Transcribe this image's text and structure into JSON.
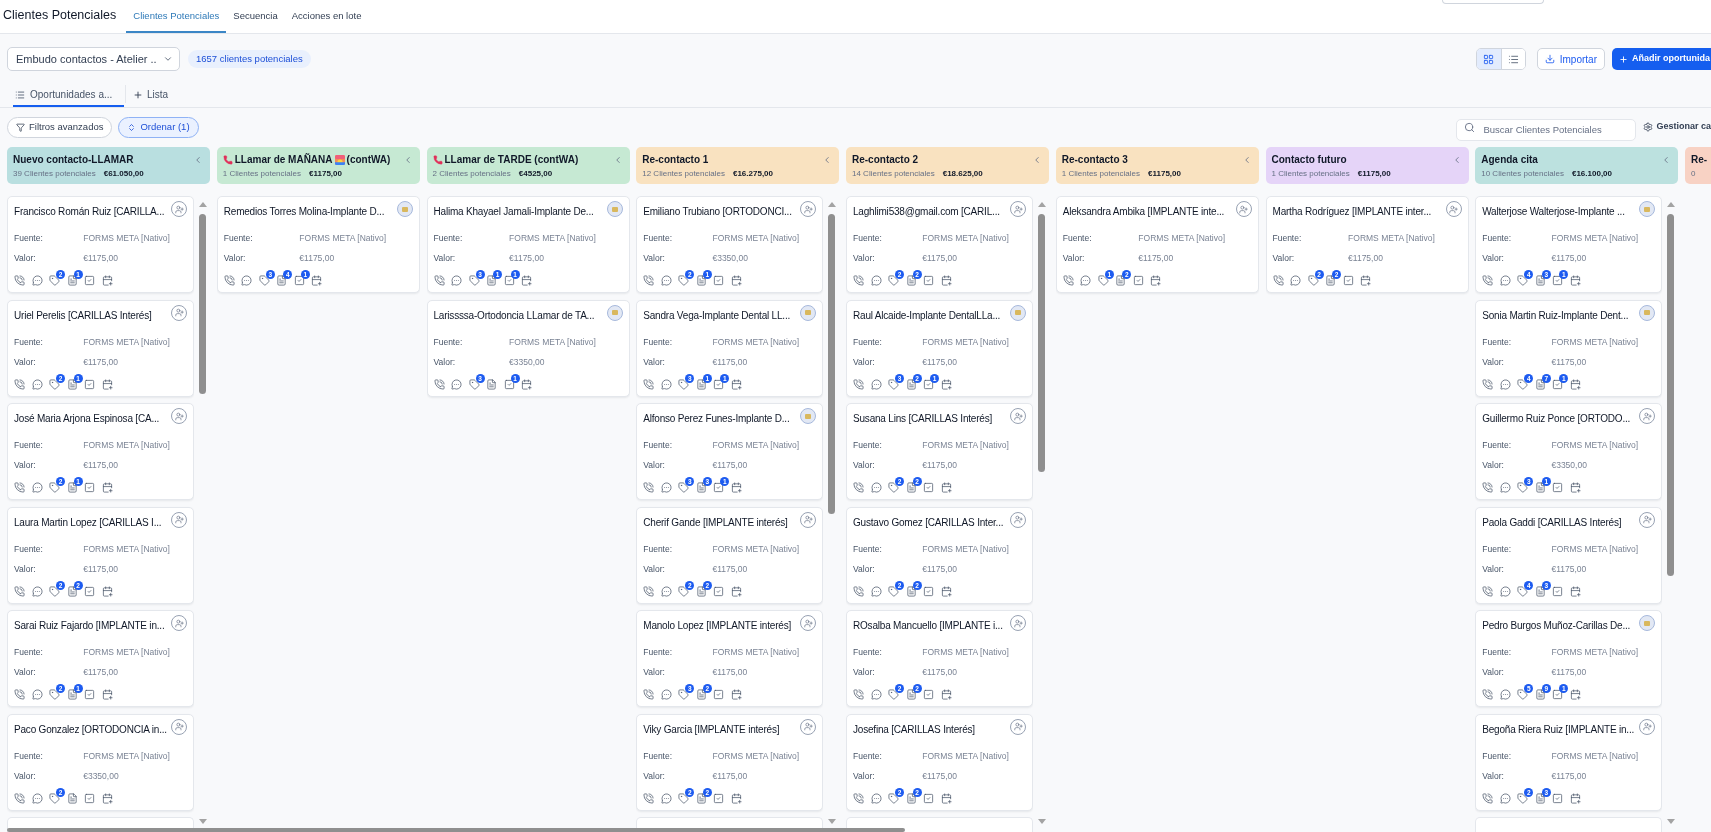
{
  "header": {
    "title": "Clientes Potenciales",
    "tabs": [
      {
        "label": "Clientes Potenciales",
        "selected": true
      },
      {
        "label": "Secuencia",
        "selected": false
      },
      {
        "label": "Acciones en lote",
        "selected": false
      }
    ]
  },
  "toolbar": {
    "pipeline": "Embudo contactos - Atelier ..",
    "lead_total": "1657 clientes potenciales",
    "views": [
      {
        "kind": "grid",
        "selected": true
      },
      {
        "kind": "list",
        "selected": false
      }
    ],
    "import": "Importar",
    "add": "Añadir oportunida"
  },
  "view_tabs": [
    {
      "label": "Oportunidades a...",
      "selected": true
    }
  ],
  "add_view": "Lista",
  "filters": {
    "advanced": "Filtros avanzados",
    "sort": {
      "label": "Ordenar (1)",
      "active": true
    },
    "search": {
      "placeholder": "Buscar Clientes Potenciales"
    },
    "manage": "Gestionar ca"
  },
  "columns": [
    {
      "title": "Nuevo contacto-LLAMAR",
      "kind": "stage",
      "color": "#b9dfe0",
      "count": "39 Clientes potenciales",
      "total": "€61.050,00",
      "scrollable": true,
      "cards": [
        {
          "kind": "unassigned",
          "name": "Francisco Román Ruiz [CARILLA...",
          "fields": [
            {
              "label": "Fuente:",
              "value": "FORMS META [Nativo]"
            },
            {
              "label": "Valor:",
              "value": "€1175,00"
            }
          ],
          "counts": {
            "tags": "2",
            "notes": "1"
          }
        },
        {
          "kind": "unassigned",
          "name": "Uriel Perelis [CARILLAS Interés]",
          "fields": [
            {
              "label": "Fuente:",
              "value": "FORMS META [Nativo]"
            },
            {
              "label": "Valor:",
              "value": "€1175,00"
            }
          ],
          "counts": {
            "tags": "2",
            "notes": "1"
          }
        },
        {
          "kind": "unassigned",
          "name": "José Maria Arjona Espinosa [CA...",
          "fields": [
            {
              "label": "Fuente:",
              "value": "FORMS META [Nativo]"
            },
            {
              "label": "Valor:",
              "value": "€1175,00"
            }
          ],
          "counts": {
            "tags": "2",
            "notes": "1"
          }
        },
        {
          "kind": "unassigned",
          "name": "Laura Martin Lopez [CARILLAS I...",
          "fields": [
            {
              "label": "Fuente:",
              "value": "FORMS META [Nativo]"
            },
            {
              "label": "Valor:",
              "value": "€1175,00"
            }
          ],
          "counts": {
            "tags": "2",
            "notes": "2"
          }
        },
        {
          "kind": "unassigned",
          "name": "Sarai Ruiz Fajardo [IMPLANTE in...",
          "fields": [
            {
              "label": "Fuente:",
              "value": "FORMS META [Nativo]"
            },
            {
              "label": "Valor:",
              "value": "€1175,00"
            }
          ],
          "counts": {
            "tags": "2",
            "notes": "1"
          }
        },
        {
          "kind": "unassigned",
          "name": "Paco Gonzalez [ORTODONCIA in...",
          "fields": [
            {
              "label": "Fuente:",
              "value": "FORMS META [Nativo]"
            },
            {
              "label": "Valor:",
              "value": "€3350,00"
            }
          ],
          "counts": {
            "tags": "2"
          }
        }
      ]
    },
    {
      "title": "LLamar de MAÑANA",
      "title_suffix": "(contWA)",
      "kind": "call_morning",
      "color": "#c6e9d3",
      "count": "1 Clientes potenciales",
      "total": "€1175,00",
      "scrollable": false,
      "cards": [
        {
          "kind": "assigned",
          "name": "Remedios Torres Molina-Implante D...",
          "fields": [
            {
              "label": "Fuente:",
              "value": "FORMS META [Nativo]"
            },
            {
              "label": "Valor:",
              "value": "€1175,00"
            }
          ],
          "counts": {
            "tags": "3",
            "notes": "4",
            "tasks": "1"
          }
        }
      ]
    },
    {
      "title": "LLamar de TARDE (contWA)",
      "kind": "call",
      "color": "#c6e9d3",
      "count": "2 Clientes potenciales",
      "total": "€4525,00",
      "scrollable": false,
      "cards": [
        {
          "kind": "assigned",
          "name": "Halima Khayael Jamali-Implante De...",
          "fields": [
            {
              "label": "Fuente:",
              "value": "FORMS META [Nativo]"
            },
            {
              "label": "Valor:",
              "value": "€1175,00"
            }
          ],
          "counts": {
            "tags": "3",
            "notes": "1",
            "tasks": "1"
          }
        },
        {
          "kind": "assigned",
          "name": "Larissssa-Ortodoncia LLamar de TA...",
          "fields": [
            {
              "label": "Fuente:",
              "value": "FORMS META [Nativo]"
            },
            {
              "label": "Valor:",
              "value": "€3350,00"
            }
          ],
          "counts": {
            "tags": "3",
            "tasks": "1"
          }
        }
      ]
    },
    {
      "title": "Re-contacto 1",
      "kind": "stage",
      "color": "#f9e2c0",
      "count": "12 Clientes potenciales",
      "total": "€16.275,00",
      "scrollable": true,
      "cards": [
        {
          "kind": "unassigned",
          "name": "Emiliano Trubiano [ORTODONCI...",
          "fields": [
            {
              "label": "Fuente:",
              "value": "FORMS META [Nativo]"
            },
            {
              "label": "Valor:",
              "value": "€3350,00"
            }
          ],
          "counts": {
            "tags": "2",
            "notes": "1"
          }
        },
        {
          "kind": "assigned",
          "name": "Sandra Vega-Implante Dental LL...",
          "fields": [
            {
              "label": "Fuente:",
              "value": "FORMS META [Nativo]"
            },
            {
              "label": "Valor:",
              "value": "€1175,00"
            }
          ],
          "counts": {
            "tags": "3",
            "notes": "1",
            "tasks": "1"
          }
        },
        {
          "kind": "assigned",
          "name": "Alfonso Perez Funes-Implante D...",
          "fields": [
            {
              "label": "Fuente:",
              "value": "FORMS META [Nativo]"
            },
            {
              "label": "Valor:",
              "value": "€1175,00"
            }
          ],
          "counts": {
            "tags": "3",
            "notes": "3",
            "tasks": "1"
          }
        },
        {
          "kind": "unassigned",
          "name": "Cherif Gande [IMPLANTE interés]",
          "fields": [
            {
              "label": "Fuente:",
              "value": "FORMS META [Nativo]"
            },
            {
              "label": "Valor:",
              "value": "€1175,00"
            }
          ],
          "counts": {
            "tags": "2",
            "notes": "2"
          }
        },
        {
          "kind": "unassigned",
          "name": "Manolo Lopez [IMPLANTE interés]",
          "fields": [
            {
              "label": "Fuente:",
              "value": "FORMS META [Nativo]"
            },
            {
              "label": "Valor:",
              "value": "€1175,00"
            }
          ],
          "counts": {
            "tags": "3",
            "notes": "2"
          }
        },
        {
          "kind": "unassigned",
          "name": "Viky Garcia [IMPLANTE interés]",
          "fields": [
            {
              "label": "Fuente:",
              "value": "FORMS META [Nativo]"
            },
            {
              "label": "Valor:",
              "value": "€1175,00"
            }
          ],
          "counts": {
            "tags": "2",
            "notes": "2"
          }
        }
      ]
    },
    {
      "title": "Re-contacto 2",
      "kind": "stage",
      "color": "#f9e2c0",
      "count": "14 Clientes potenciales",
      "total": "€18.625,00",
      "scrollable": true,
      "cards": [
        {
          "kind": "unassigned",
          "name": "Laghlimi538@gmail.com [CARIL...",
          "fields": [
            {
              "label": "Fuente:",
              "value": "FORMS META [Nativo]"
            },
            {
              "label": "Valor:",
              "value": "€1175,00"
            }
          ],
          "counts": {
            "tags": "2",
            "notes": "2"
          }
        },
        {
          "kind": "assigned",
          "name": "Raul Alcaide-Implante DentalLLa...",
          "fields": [
            {
              "label": "Fuente:",
              "value": "FORMS META [Nativo]"
            },
            {
              "label": "Valor:",
              "value": "€1175,00"
            }
          ],
          "counts": {
            "tags": "3",
            "notes": "2",
            "tasks": "1"
          }
        },
        {
          "kind": "unassigned",
          "name": "Susana Lins [CARILLAS Interés]",
          "fields": [
            {
              "label": "Fuente:",
              "value": "FORMS META [Nativo]"
            },
            {
              "label": "Valor:",
              "value": "€1175,00"
            }
          ],
          "counts": {
            "tags": "2",
            "notes": "2"
          }
        },
        {
          "kind": "unassigned",
          "name": "Gustavo Gomez [CARILLAS Inter...",
          "fields": [
            {
              "label": "Fuente:",
              "value": "FORMS META [Nativo]"
            },
            {
              "label": "Valor:",
              "value": "€1175,00"
            }
          ],
          "counts": {
            "tags": "2",
            "notes": "2"
          }
        },
        {
          "kind": "unassigned",
          "name": "ROsalba Mancuello [IMPLANTE i...",
          "fields": [
            {
              "label": "Fuente:",
              "value": "FORMS META [Nativo]"
            },
            {
              "label": "Valor:",
              "value": "€1175,00"
            }
          ],
          "counts": {
            "tags": "2",
            "notes": "2"
          }
        },
        {
          "kind": "unassigned",
          "name": "Josefina [CARILLAS Interés]",
          "fields": [
            {
              "label": "Fuente:",
              "value": "FORMS META [Nativo]"
            },
            {
              "label": "Valor:",
              "value": "€1175,00"
            }
          ],
          "counts": {
            "tags": "2",
            "notes": "2"
          }
        }
      ]
    },
    {
      "title": "Re-contacto 3",
      "kind": "stage",
      "color": "#f9e2c0",
      "count": "1 Clientes potenciales",
      "total": "€1175,00",
      "scrollable": false,
      "cards": [
        {
          "kind": "unassigned",
          "name": "Aleksandra Ambika [IMPLANTE inte...",
          "fields": [
            {
              "label": "Fuente:",
              "value": "FORMS META [Nativo]"
            },
            {
              "label": "Valor:",
              "value": "€1175,00"
            }
          ],
          "counts": {
            "tags": "1",
            "notes": "2"
          }
        }
      ]
    },
    {
      "title": "Contacto futuro",
      "kind": "stage",
      "color": "#e5d4f8",
      "count": "1 Clientes potenciales",
      "total": "€1175,00",
      "scrollable": false,
      "cards": [
        {
          "kind": "unassigned",
          "name": "Martha Rodríguez [IMPLANTE inter...",
          "fields": [
            {
              "label": "Fuente:",
              "value": "FORMS META [Nativo]"
            },
            {
              "label": "Valor:",
              "value": "€1175,00"
            }
          ],
          "counts": {
            "tags": "2",
            "notes": "2"
          }
        }
      ]
    },
    {
      "title": "Agenda cita",
      "kind": "stage",
      "color": "#bce1df",
      "count": "10 Clientes potenciales",
      "total": "€16.100,00",
      "scrollable": true,
      "cards": [
        {
          "kind": "assigned",
          "name": "Walterjose Walterjose-Implante ...",
          "fields": [
            {
              "label": "Fuente:",
              "value": "FORMS META [Nativo]"
            },
            {
              "label": "Valor:",
              "value": "€1175,00"
            }
          ],
          "counts": {
            "tags": "4",
            "notes": "3",
            "tasks": "1"
          }
        },
        {
          "kind": "assigned",
          "name": "Sonia Martin Ruiz-Implante Dent...",
          "fields": [
            {
              "label": "Fuente:",
              "value": "FORMS META [Nativo]"
            },
            {
              "label": "Valor:",
              "value": "€1175,00"
            }
          ],
          "counts": {
            "tags": "4",
            "notes": "7",
            "tasks": "1"
          }
        },
        {
          "kind": "unassigned",
          "name": "Guillermo Ruiz Ponce [ORTODO...",
          "fields": [
            {
              "label": "Fuente:",
              "value": "FORMS META [Nativo]"
            },
            {
              "label": "Valor:",
              "value": "€3350,00"
            }
          ],
          "counts": {
            "tags": "3",
            "notes": "1"
          }
        },
        {
          "kind": "unassigned",
          "name": "Paola Gaddi [CARILLAS Interés]",
          "fields": [
            {
              "label": "Fuente:",
              "value": "FORMS META [Nativo]"
            },
            {
              "label": "Valor:",
              "value": "€1175,00"
            }
          ],
          "counts": {
            "tags": "4",
            "notes": "3"
          }
        },
        {
          "kind": "assigned",
          "name": "Pedro Burgos Muñoz-Carillas De...",
          "fields": [
            {
              "label": "Fuente:",
              "value": "FORMS META [Nativo]"
            },
            {
              "label": "Valor:",
              "value": "€1175,00"
            }
          ],
          "counts": {
            "tags": "5",
            "notes": "9",
            "tasks": "1"
          }
        },
        {
          "kind": "unassigned",
          "name": "Begoña Riera Ruiz [IMPLANTE in...",
          "fields": [
            {
              "label": "Fuente:",
              "value": "FORMS META [Nativo]"
            },
            {
              "label": "Valor:",
              "value": "€1175,00"
            }
          ],
          "counts": {
            "tags": "2",
            "notes": "3"
          }
        }
      ]
    },
    {
      "title": "Re-",
      "kind": "stage",
      "color": "#f8d2c4",
      "count": "0",
      "scrollable": false
    }
  ]
}
